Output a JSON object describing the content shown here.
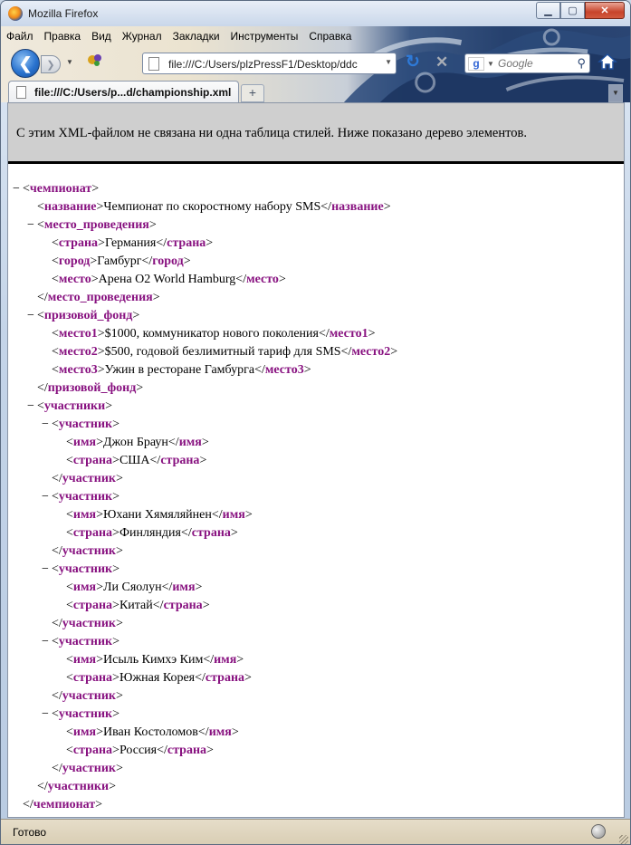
{
  "window": {
    "title": "Mozilla Firefox"
  },
  "menu": [
    "Файл",
    "Правка",
    "Вид",
    "Журнал",
    "Закладки",
    "Инструменты",
    "Справка"
  ],
  "toolbar": {
    "url": "file:///C:/Users/plzPressF1/Desktop/ddc",
    "search_placeholder": "Google"
  },
  "tab": {
    "label": "file:///C:/Users/p...d/championship.xml"
  },
  "notice": "С этим XML-файлом не связана ни одна таблица стилей. Ниже показано дерево элементов.",
  "tree": [
    {
      "d": 0,
      "tog": "−",
      "kind": "open",
      "tag": "чемпионат"
    },
    {
      "d": 1,
      "tog": "",
      "kind": "leaf",
      "tag": "название",
      "text": "Чемпионат по скоростному набору SMS"
    },
    {
      "d": 1,
      "tog": "−",
      "kind": "open",
      "tag": "место_проведения"
    },
    {
      "d": 2,
      "tog": "",
      "kind": "leaf",
      "tag": "страна",
      "text": "Германия"
    },
    {
      "d": 2,
      "tog": "",
      "kind": "leaf",
      "tag": "город",
      "text": "Гамбург"
    },
    {
      "d": 2,
      "tog": "",
      "kind": "leaf",
      "tag": "место",
      "text": "Арена O2 World Hamburg"
    },
    {
      "d": 1,
      "tog": "",
      "kind": "close",
      "tag": "место_проведения"
    },
    {
      "d": 1,
      "tog": "−",
      "kind": "open",
      "tag": "призовой_фонд"
    },
    {
      "d": 2,
      "tog": "",
      "kind": "leaf",
      "tag": "место1",
      "text": "$1000, коммуникатор нового поколения"
    },
    {
      "d": 2,
      "tog": "",
      "kind": "leaf",
      "tag": "место2",
      "text": "$500, годовой безлимитный тариф для SMS"
    },
    {
      "d": 2,
      "tog": "",
      "kind": "leaf",
      "tag": "место3",
      "text": "Ужин в ресторане Гамбурга"
    },
    {
      "d": 1,
      "tog": "",
      "kind": "close",
      "tag": "призовой_фонд"
    },
    {
      "d": 1,
      "tog": "−",
      "kind": "open",
      "tag": "участники"
    },
    {
      "d": 2,
      "tog": "−",
      "kind": "open",
      "tag": "участник"
    },
    {
      "d": 3,
      "tog": "",
      "kind": "leaf",
      "tag": "имя",
      "text": "Джон Браун"
    },
    {
      "d": 3,
      "tog": "",
      "kind": "leaf",
      "tag": "страна",
      "text": "США"
    },
    {
      "d": 2,
      "tog": "",
      "kind": "close",
      "tag": "участник"
    },
    {
      "d": 2,
      "tog": "−",
      "kind": "open",
      "tag": "участник"
    },
    {
      "d": 3,
      "tog": "",
      "kind": "leaf",
      "tag": "имя",
      "text": "Юхани Хямяляйнен"
    },
    {
      "d": 3,
      "tog": "",
      "kind": "leaf",
      "tag": "страна",
      "text": "Финляндия"
    },
    {
      "d": 2,
      "tog": "",
      "kind": "close",
      "tag": "участник"
    },
    {
      "d": 2,
      "tog": "−",
      "kind": "open",
      "tag": "участник"
    },
    {
      "d": 3,
      "tog": "",
      "kind": "leaf",
      "tag": "имя",
      "text": "Ли Сяолун"
    },
    {
      "d": 3,
      "tog": "",
      "kind": "leaf",
      "tag": "страна",
      "text": "Китай"
    },
    {
      "d": 2,
      "tog": "",
      "kind": "close",
      "tag": "участник"
    },
    {
      "d": 2,
      "tog": "−",
      "kind": "open",
      "tag": "участник"
    },
    {
      "d": 3,
      "tog": "",
      "kind": "leaf",
      "tag": "имя",
      "text": "Исыль Кимхэ Ким"
    },
    {
      "d": 3,
      "tog": "",
      "kind": "leaf",
      "tag": "страна",
      "text": "Южная Корея"
    },
    {
      "d": 2,
      "tog": "",
      "kind": "close",
      "tag": "участник"
    },
    {
      "d": 2,
      "tog": "−",
      "kind": "open",
      "tag": "участник"
    },
    {
      "d": 3,
      "tog": "",
      "kind": "leaf",
      "tag": "имя",
      "text": "Иван Костоломов"
    },
    {
      "d": 3,
      "tog": "",
      "kind": "leaf",
      "tag": "страна",
      "text": "Россия"
    },
    {
      "d": 2,
      "tog": "",
      "kind": "close",
      "tag": "участник"
    },
    {
      "d": 1,
      "tog": "",
      "kind": "close",
      "tag": "участники"
    },
    {
      "d": 0,
      "tog": "",
      "kind": "close",
      "tag": "чемпионат"
    }
  ],
  "status": {
    "text": "Готово"
  },
  "colors": {
    "tag": "#881280",
    "notice_bg": "#cfcfcf"
  }
}
